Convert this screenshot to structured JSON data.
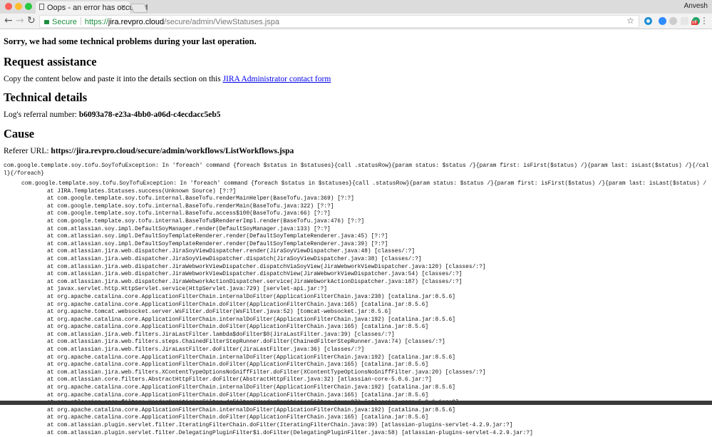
{
  "browser": {
    "tab_title": "Oops - an error has occurred",
    "user": "Anvesh",
    "secure_label": "Secure",
    "url_protocol": "https://",
    "url_host": "jira.revpro.cloud",
    "url_path": "/secure/admin/ViewStatuses.jspa",
    "extension_badge": "off",
    "colors": {
      "secure": "#1e8e3e",
      "link": "#0000ee"
    }
  },
  "page": {
    "sorry": "Sorry, we had some technical problems during your last operation.",
    "request_heading": "Request assistance",
    "request_text": "Copy the content below and paste it into the details section on this ",
    "request_link": "JIRA Administrator contact form",
    "technical_heading": "Technical details",
    "referral_label": "Log's referral number: ",
    "referral_number": "b6093a78-e23a-4bb0-a06d-c4ecdacc5eb5",
    "cause_heading": "Cause",
    "referer_label": "Referer URL: ",
    "referer_url": "https://jira.revpro.cloud/secure/admin/workflows/ListWorkflows.jspa",
    "exception_summary": "com.google.template.soy.tofu.SoyTofuException: In 'foreach' command {foreach $status in $statuses}{call .statusRow}{param status: $status /}{param first: isFirst($status) /}{param last: isLast($status) /}{/call}{/foreach}",
    "exception_header": "com.google.template.soy.tofu.SoyTofuException: In 'foreach' command {foreach $status in $statuses}{call .statusRow}{param status: $status /}{param first: isFirst($status) /}{param last: isLast($status) /",
    "stack": [
      "at JIRA.Templates.Statuses.success(Unknown Source) [?:?]",
      "at com.google.template.soy.tofu.internal.BaseTofu.renderMainHelper(BaseTofu.java:369) [?:?]",
      "at com.google.template.soy.tofu.internal.BaseTofu.renderMain(BaseTofu.java:322) [?:?]",
      "at com.google.template.soy.tofu.internal.BaseTofu.access$100(BaseTofu.java:66) [?:?]",
      "at com.google.template.soy.tofu.internal.BaseTofu$RendererImpl.render(BaseTofu.java:476) [?:?]",
      "at com.atlassian.soy.impl.DefaultSoyManager.render(DefaultSoyManager.java:133) [?:?]",
      "at com.atlassian.soy.impl.DefaultSoyTemplateRenderer.render(DefaultSoyTemplateRenderer.java:45) [?:?]",
      "at com.atlassian.soy.impl.DefaultSoyTemplateRenderer.render(DefaultSoyTemplateRenderer.java:39) [?:?]",
      "at com.atlassian.jira.web.dispatcher.JiraSoyViewDispatcher.render(JiraSoyViewDispatcher.java:48) [classes/:?]",
      "at com.atlassian.jira.web.dispatcher.JiraSoyViewDispatcher.dispatch(JiraSoyViewDispatcher.java:38) [classes/:?]",
      "at com.atlassian.jira.web.dispatcher.JiraWebworkViewDispatcher.dispatchViaSoyView(JiraWebworkViewDispatcher.java:120) [classes/:?]",
      "at com.atlassian.jira.web.dispatcher.JiraWebworkViewDispatcher.dispatchView(JiraWebworkViewDispatcher.java:54) [classes/:?]",
      "at com.atlassian.jira.web.dispatcher.JiraWebworkActionDispatcher.service(JiraWebworkActionDispatcher.java:187) [classes/:?]",
      "at javax.servlet.http.HttpServlet.service(HttpServlet.java:729) [servlet-api.jar:?]",
      "at org.apache.catalina.core.ApplicationFilterChain.internalDoFilter(ApplicationFilterChain.java:230) [catalina.jar:8.5.6]",
      "at org.apache.catalina.core.ApplicationFilterChain.doFilter(ApplicationFilterChain.java:165) [catalina.jar:8.5.6]",
      "at org.apache.tomcat.websocket.server.WsFilter.doFilter(WsFilter.java:52) [tomcat-websocket.jar:8.5.6]",
      "at org.apache.catalina.core.ApplicationFilterChain.internalDoFilter(ApplicationFilterChain.java:192) [catalina.jar:8.5.6]",
      "at org.apache.catalina.core.ApplicationFilterChain.doFilter(ApplicationFilterChain.java:165) [catalina.jar:8.5.6]",
      "at com.atlassian.jira.web.filters.JiraLastFilter.lambda$doFilter$0(JiraLastFilter.java:39) [classes/:?]",
      "at com.atlassian.jira.web.filters.steps.ChainedFilterStepRunner.doFilter(ChainedFilterStepRunner.java:74) [classes/:?]",
      "at com.atlassian.jira.web.filters.JiraLastFilter.doFilter(JiraLastFilter.java:36) [classes/:?]",
      "at org.apache.catalina.core.ApplicationFilterChain.internalDoFilter(ApplicationFilterChain.java:192) [catalina.jar:8.5.6]",
      "at org.apache.catalina.core.ApplicationFilterChain.doFilter(ApplicationFilterChain.java:165) [catalina.jar:8.5.6]",
      "at com.atlassian.jira.web.filters.XContentTypeOptionsNoSniffFilter.doFilter(XContentTypeOptionsNoSniffFilter.java:20) [classes/:?]",
      "at com.atlassian.core.filters.AbstractHttpFilter.doFilter(AbstractHttpFilter.java:32) [atlassian-core-5.0.6.jar:?]",
      "at org.apache.catalina.core.ApplicationFilterChain.internalDoFilter(ApplicationFilterChain.java:192) [catalina.jar:8.5.6]",
      "at org.apache.catalina.core.ApplicationFilterChain.doFilter(ApplicationFilterChain.java:165) [catalina.jar:8.5.6]",
      "at com.atlassian.core.filters.HeaderSanitisingFilter.doFilter(HeaderSanitisingFilter.java:37) [atlassian-core-5.0.6.jar:?]",
      "at org.apache.catalina.core.ApplicationFilterChain.internalDoFilter(ApplicationFilterChain.java:192) [catalina.jar:8.5.6]",
      "at org.apache.catalina.core.ApplicationFilterChain.doFilter(ApplicationFilterChain.java:165) [catalina.jar:8.5.6]",
      "at com.atlassian.plugin.servlet.filter.IteratingFilterChain.doFilter(IteratingFilterChain.java:39) [atlassian-plugins-servlet-4.2.9.jar:?]",
      "at com.atlassian.plugin.servlet.filter.DelegatingPluginFilter$1.doFilter(DelegatingPluginFilter.java:58) [atlassian-plugins-servlet-4.2.9.jar:?]"
    ]
  }
}
